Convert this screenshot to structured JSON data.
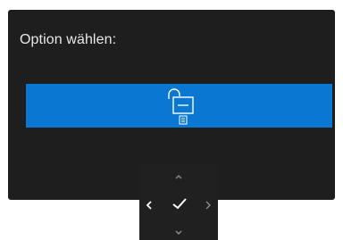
{
  "osd": {
    "title": "Option wählen:",
    "selected_option": {
      "icon": "unlock-icon",
      "sub_icon": "document-icon",
      "highlight_color": "#0a78d2"
    }
  },
  "nav_pad": {
    "up_icon": "chevron-up-icon",
    "down_icon": "chevron-down-icon",
    "left_icon": "chevron-left-icon",
    "right_icon": "chevron-right-icon",
    "ok_icon": "checkmark-icon"
  }
}
